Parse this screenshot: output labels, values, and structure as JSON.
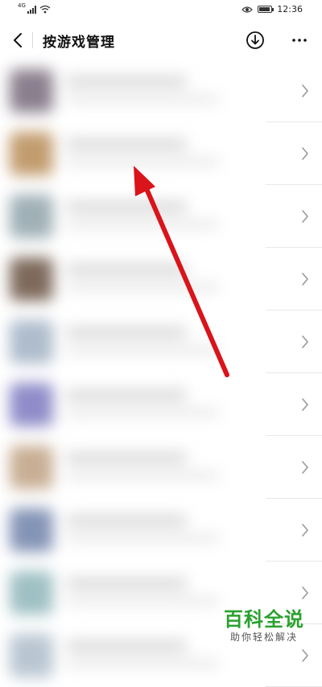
{
  "status_bar": {
    "network": "4G",
    "time": "12:36"
  },
  "header": {
    "title": "按游戏管理",
    "icons": {
      "back": "back-arrow-icon",
      "download": "download-icon",
      "more": "more-dots-icon"
    }
  },
  "list": {
    "rows": [
      {
        "avatar_color": "#8a7f8e"
      },
      {
        "avatar_color": "#c29c6e"
      },
      {
        "avatar_color": "#9fb0b6"
      },
      {
        "avatar_color": "#7e6a5c"
      },
      {
        "avatar_color": "#aebccc"
      },
      {
        "avatar_color": "#8f8cc9"
      },
      {
        "avatar_color": "#c8ae94"
      },
      {
        "avatar_color": "#8494b6"
      },
      {
        "avatar_color": "#9fc0c4"
      },
      {
        "avatar_color": "#b9c6d2"
      }
    ]
  },
  "annotation": {
    "arrow_color": "#d9141a"
  },
  "watermark": {
    "title": "百科全说",
    "subtitle": "助你轻松解决"
  }
}
